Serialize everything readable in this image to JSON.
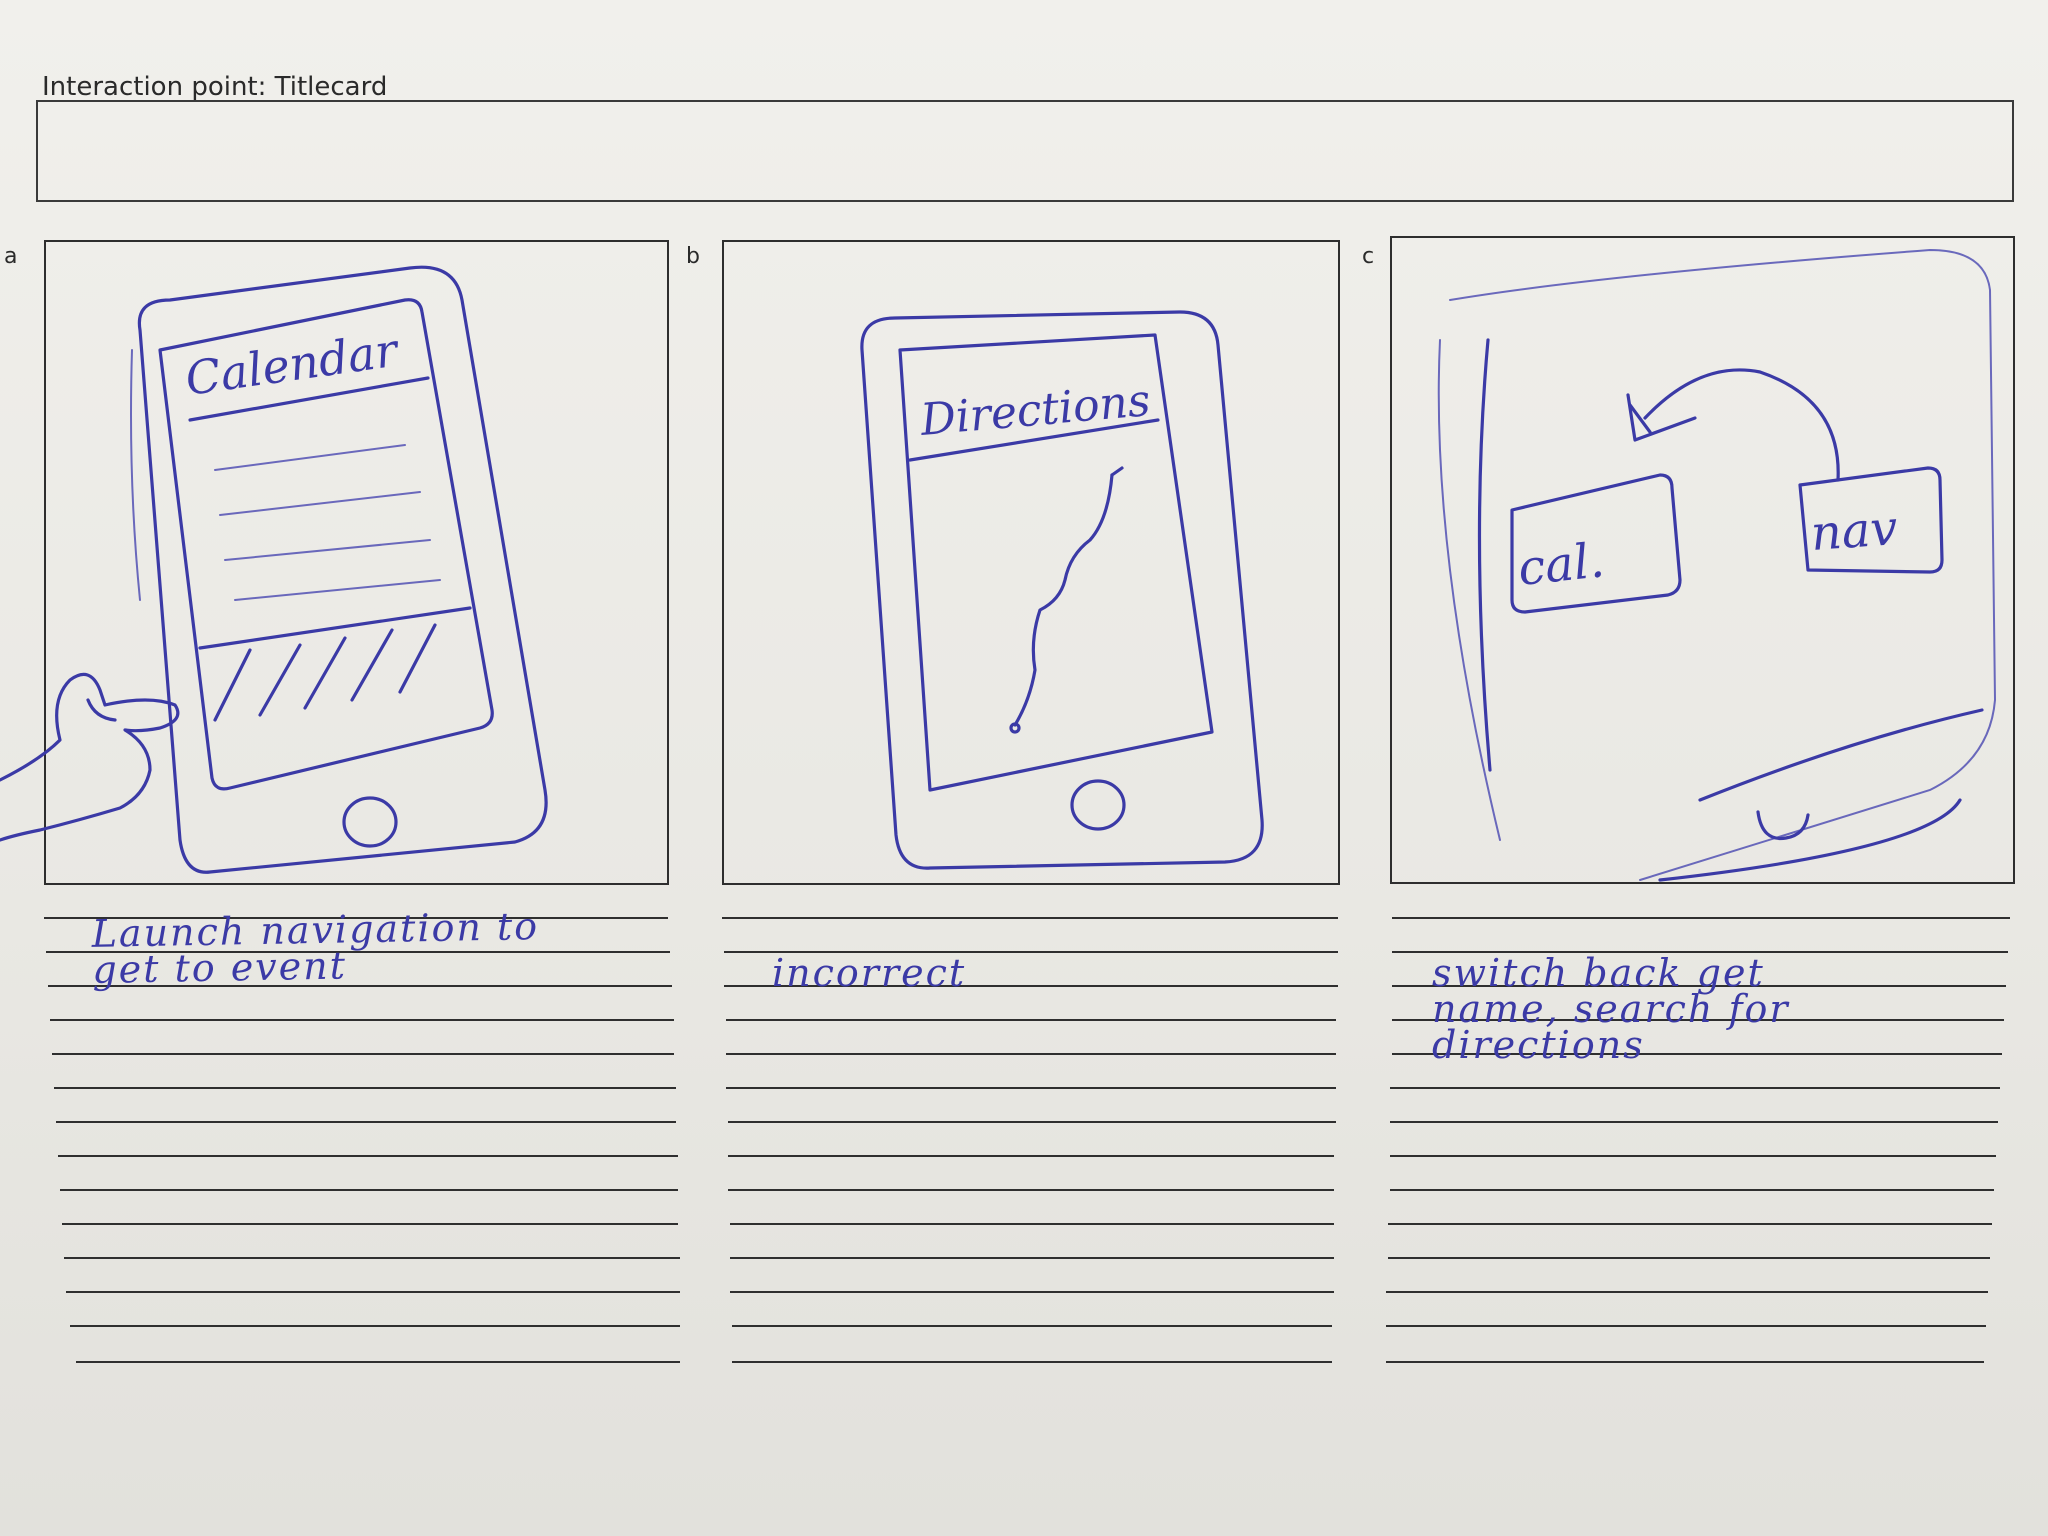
{
  "header": {
    "label": "Interaction point: Titlecard"
  },
  "panels": [
    {
      "letter": "a",
      "screen_label": "Calendar",
      "note": "Launch navigation to\nget to event"
    },
    {
      "letter": "b",
      "screen_label": "Directions",
      "note": "incorrect"
    },
    {
      "letter": "c",
      "box_left": "cal.",
      "box_right": "nav",
      "note": "switch back get\nname, search for\ndirections"
    }
  ],
  "colors": {
    "ink": "#3b3aa6",
    "paper": "#ecebe7",
    "print": "#2e2e2e"
  }
}
